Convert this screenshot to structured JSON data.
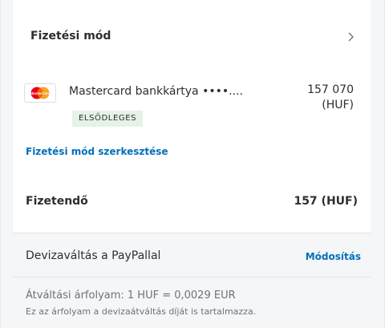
{
  "payment_method": {
    "title": "Fizetési mód",
    "card": {
      "logo_text": "MasterCard",
      "name": "Mastercard bankkártya ••••....",
      "badge": "ELSŐDLEGES",
      "amount_line1": "157 070",
      "amount_line2": "(HUF)"
    },
    "edit_link": "Fizetési mód szerkesztése"
  },
  "total": {
    "label": "Fizetendő",
    "value": "157 (HUF)"
  },
  "currency_conversion": {
    "label": "Devizaváltás a PayPallal",
    "modify_link": "Módosítás",
    "rate": "Átváltási árfolyam: 1 HUF = 0,0029 EUR",
    "note": "Ez az árfolyam a devizaátváltás díját is tartalmazza."
  },
  "colors": {
    "link": "#0070ba",
    "badge_bg": "#e5f2e6",
    "text": "#2c2e2f",
    "muted": "#6c7378",
    "mastercard_red": "#eb001b",
    "mastercard_orange": "#f79e1b"
  },
  "icons": [
    "chevron-right-icon",
    "mastercard-logo-icon"
  ]
}
